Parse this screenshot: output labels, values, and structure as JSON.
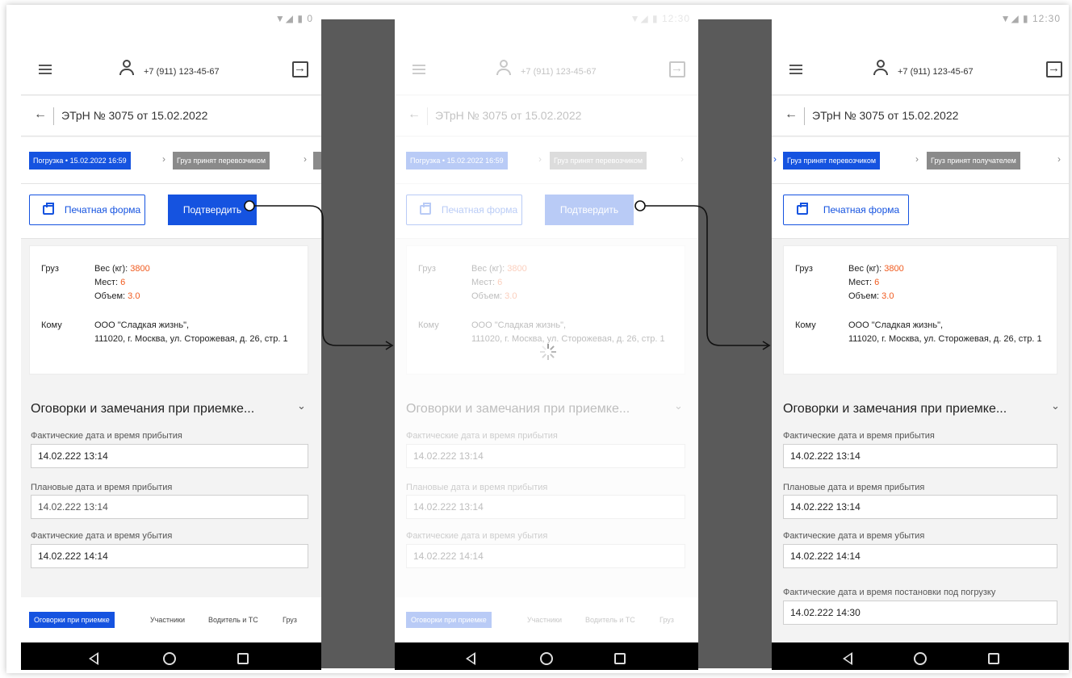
{
  "status": {
    "time_left": "0",
    "time_mid": "12:30",
    "time_right": "12:30"
  },
  "appbar": {
    "phone": "+7 (911) 123-45-67"
  },
  "document": {
    "title": "ЭТрН № 3075 от 15.02.2022"
  },
  "breadcrumbs": {
    "loading": "Погрузка • 15.02.2022 16:59",
    "accepted_by_carrier": "Груз принят перевозчиком",
    "accepted_by_receiver": "Груз принят получателем"
  },
  "actions": {
    "print_label": "Печатная форма",
    "confirm_label": "Подтвердить"
  },
  "cargo": {
    "label": "Груз",
    "weight_label": "Вес (кг): ",
    "weight_value": "3800",
    "places_label": "Мест: ",
    "places_value": "6",
    "volume_label": "Объем: ",
    "volume_value": "3.0",
    "to_label": "Кому",
    "to_line1": "ООО \"Сладкая жизнь\",",
    "to_line2": "111020, г. Москва, ул. Сторожевая, д. 26, стр. 1"
  },
  "section": {
    "title": "Оговорки и замечания при приемке..."
  },
  "fields": [
    {
      "label": "Фактические дата и время прибытия",
      "value": "14.02.222 13:14"
    },
    {
      "label": "Плановые дата и время прибытия",
      "value": "14.02.222 13:14"
    },
    {
      "label": "Фактические дата и время убытия",
      "value": "14.02.222 14:14"
    },
    {
      "label": "Фактические дата и время постановки под погрузку",
      "value": "14.02.222 14:30"
    }
  ],
  "tabs": [
    "Оговорки при приемке",
    "Участники",
    "Водитель и ТС",
    "Груз"
  ],
  "colors": {
    "primary": "#1553e0",
    "accent": "#f05a1e",
    "gap": "#5a5a5a"
  }
}
